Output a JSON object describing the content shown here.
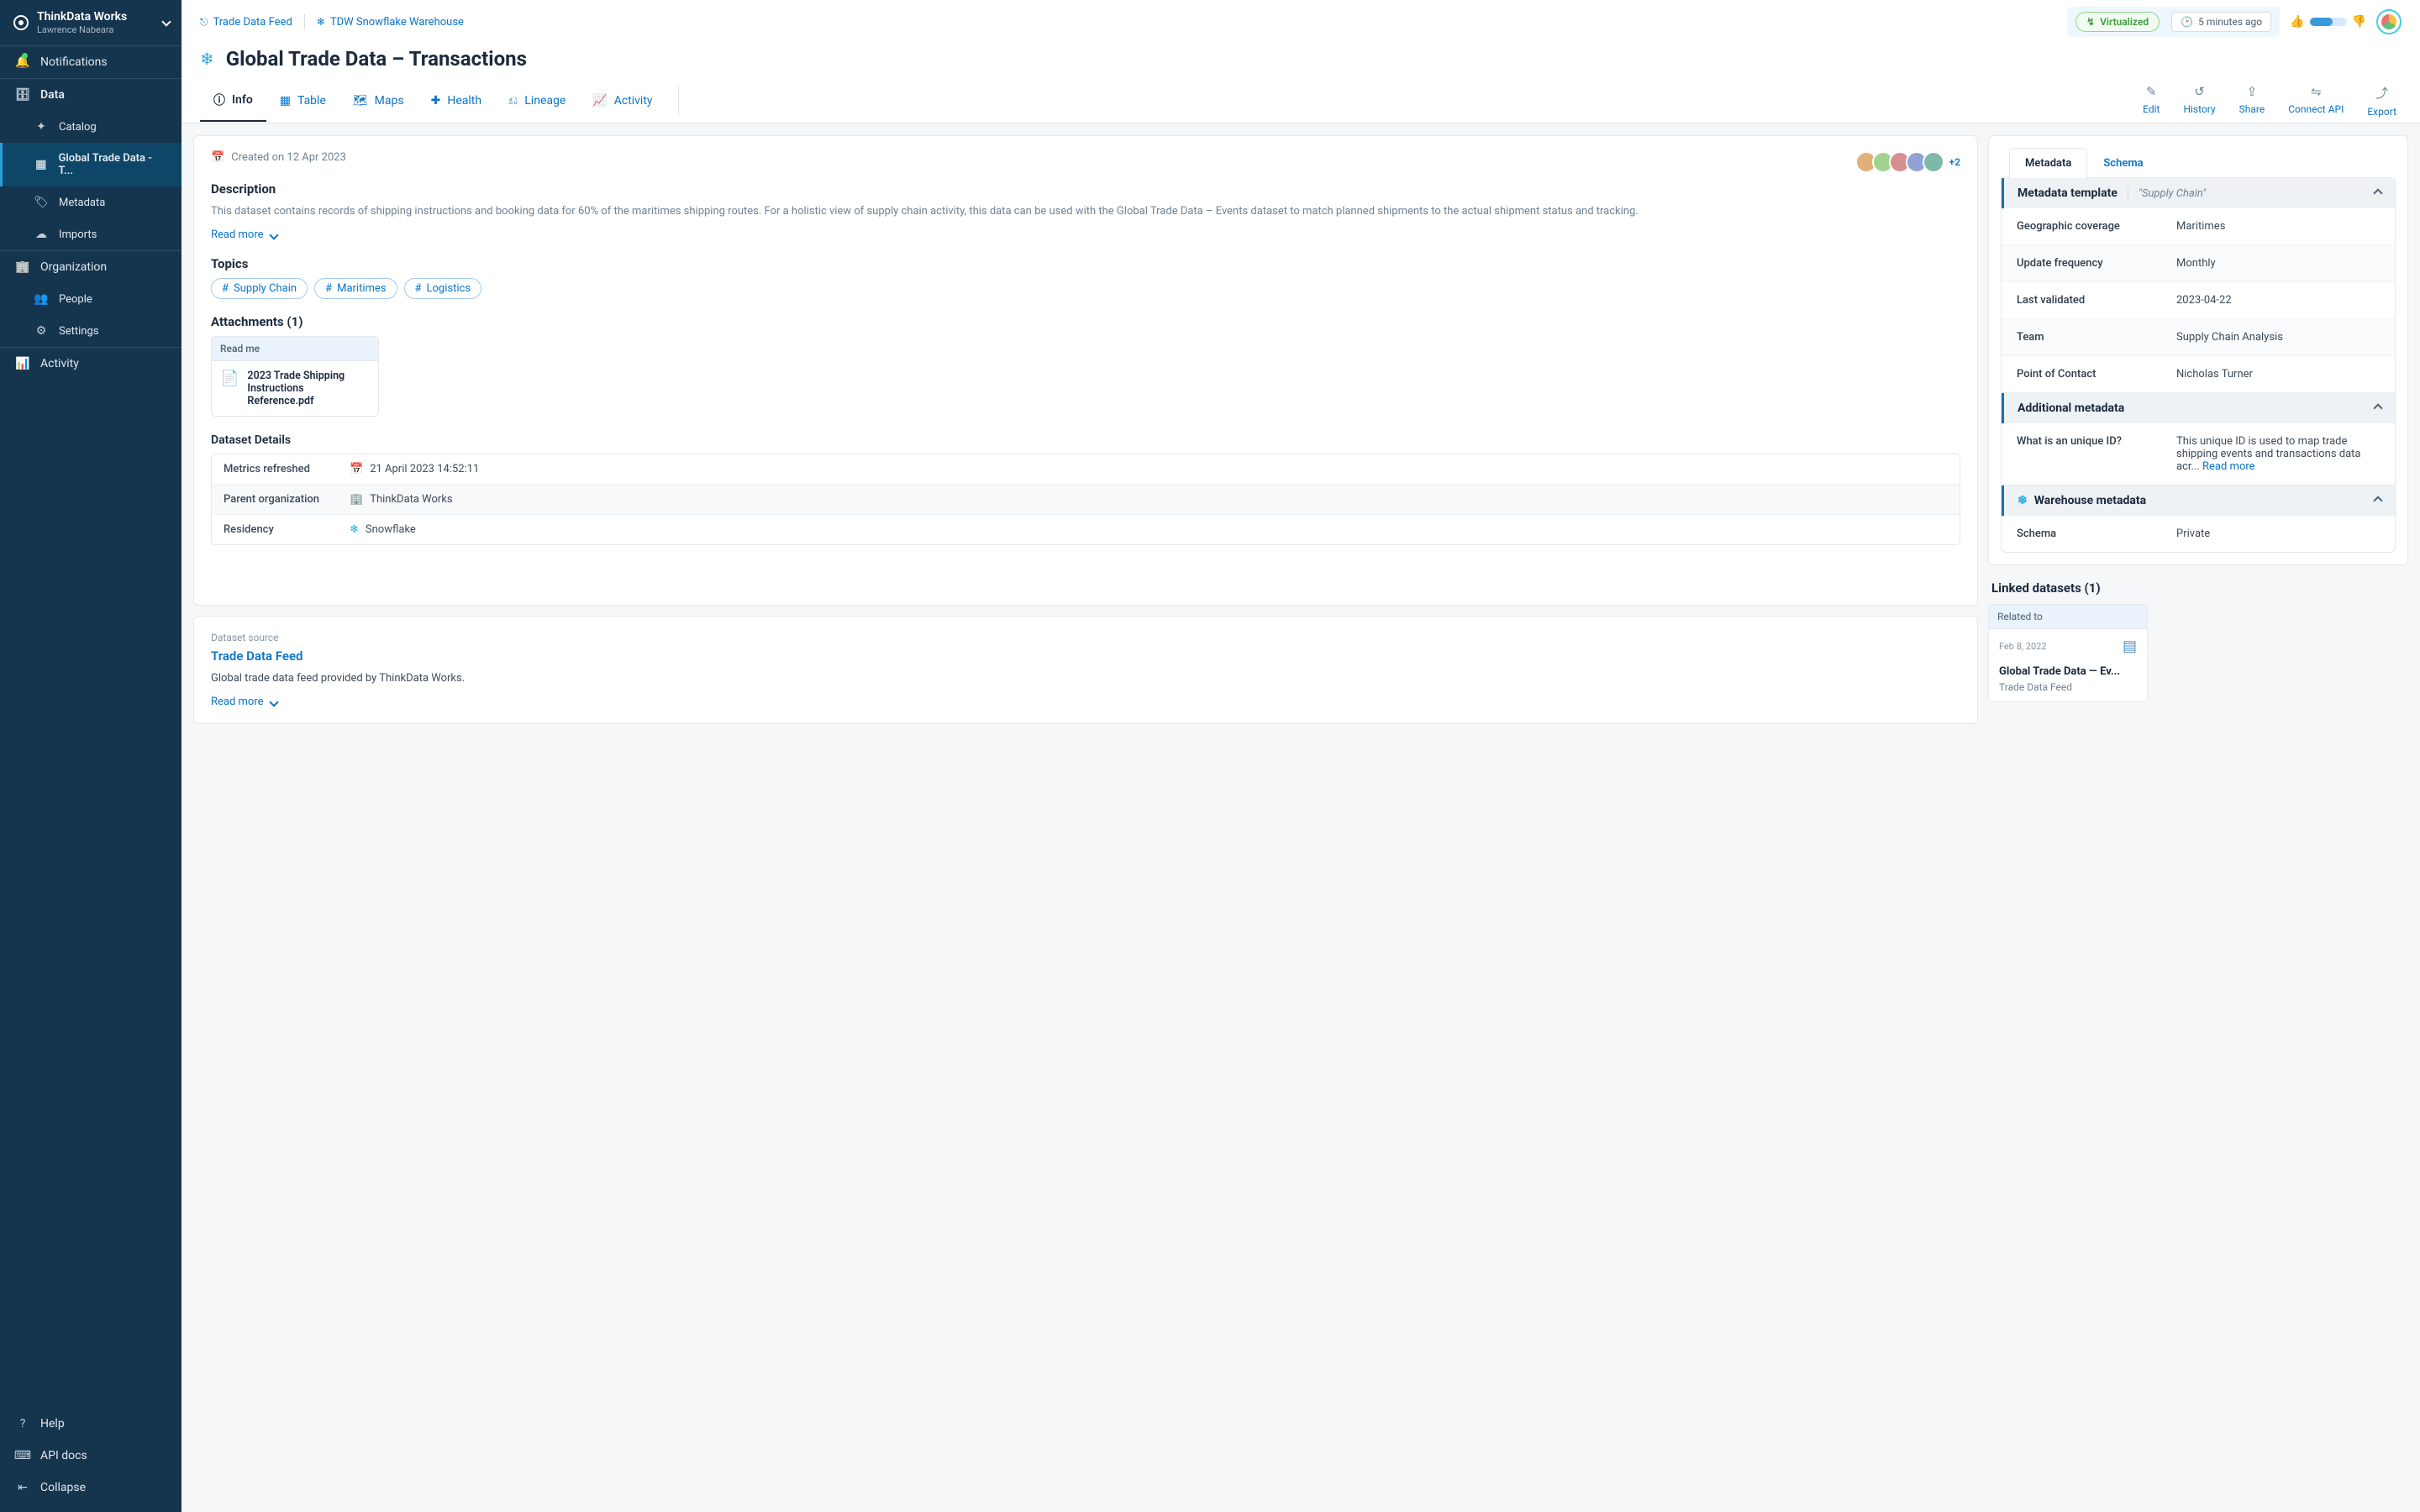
{
  "workspace": {
    "name": "ThinkData Works",
    "user": "Lawrence Nabeara"
  },
  "sidebar": {
    "notifications": "Notifications",
    "data": "Data",
    "data_items": {
      "catalog": "Catalog",
      "current": "Global Trade Data - T...",
      "metadata": "Metadata",
      "imports": "Imports"
    },
    "organization": "Organization",
    "org_items": {
      "people": "People",
      "settings": "Settings"
    },
    "activity": "Activity",
    "footer": {
      "help": "Help",
      "api": "API docs",
      "collapse": "Collapse"
    }
  },
  "breadcrumbs": {
    "feed": "Trade Data Feed",
    "warehouse": "TDW Snowflake Warehouse"
  },
  "status": {
    "virtualized": "Virtualized",
    "time": "5 minutes ago"
  },
  "page_title": "Global Trade Data – Transactions",
  "tabs": {
    "info": "Info",
    "table": "Table",
    "maps": "Maps",
    "health": "Health",
    "lineage": "Lineage",
    "activity": "Activity"
  },
  "actions": {
    "edit": "Edit",
    "history": "History",
    "share": "Share",
    "connect": "Connect API",
    "export": "Export"
  },
  "overview": {
    "created": "Created on 12 Apr 2023",
    "avatar_plus": "+2",
    "desc_h": "Description",
    "desc": "This dataset contains records of shipping instructions and booking data for 60% of the maritimes shipping routes. For a holistic view of supply chain activity, this data can be used with the Global Trade Data – Events dataset to match planned shipments to the actual shipment status and tracking.",
    "read_more": "Read more",
    "topics_h": "Topics",
    "topics": [
      "Supply Chain",
      "Maritimes",
      "Logistics"
    ],
    "attach_h": "Attachments (1)",
    "attach_label": "Read me",
    "attach_file": "2023 Trade Shipping Instructions Reference.pdf",
    "details_h": "Dataset Details",
    "details": {
      "metrics_l": "Metrics refreshed",
      "metrics_v": "21 April 2023 14:52:11",
      "parent_l": "Parent organization",
      "parent_v": "ThinkData Works",
      "residency_l": "Residency",
      "residency_v": "Snowflake"
    }
  },
  "source_card": {
    "label": "Dataset source",
    "link": "Trade Data Feed",
    "desc": "Global trade data feed provided by ThinkData Works.",
    "read_more": "Read more"
  },
  "meta_tabs": {
    "metadata": "Metadata",
    "schema": "Schema"
  },
  "meta_template": {
    "head": "Metadata template",
    "sub": "\"Supply Chain\"",
    "rows": {
      "geo_l": "Geographic coverage",
      "geo_v": "Maritimes",
      "freq_l": "Update frequency",
      "freq_v": "Monthly",
      "lastv_l": "Last validated",
      "lastv_v": "2023-04-22",
      "team_l": "Team",
      "team_v": "Supply Chain Analysis",
      "poc_l": "Point of Contact",
      "poc_v": "Nicholas Turner"
    }
  },
  "additional": {
    "head": "Additional metadata",
    "q_l": "What is an unique ID?",
    "q_v": "This unique ID is used to map trade shipping events and transactions data acr... ",
    "read_more": "Read more"
  },
  "warehouse": {
    "head": "Warehouse metadata",
    "schema_l": "Schema",
    "schema_v": "Private"
  },
  "linked": {
    "head": "Linked datasets (1)",
    "rel": "Related to",
    "date": "Feb 8, 2022",
    "title": "Global Trade Data — Ev...",
    "sub": "Trade Data Feed"
  }
}
